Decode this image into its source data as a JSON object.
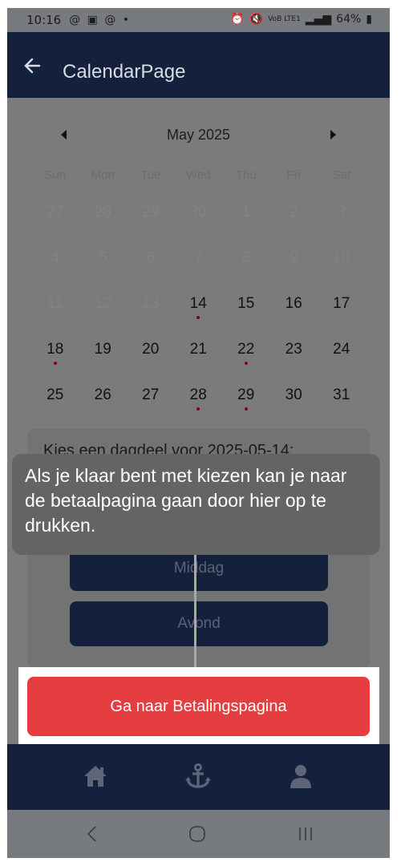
{
  "status_bar": {
    "time": "10:16",
    "left_icons": "@ ▣ @ •",
    "battery": "64%",
    "network": "VoB LTE1"
  },
  "app_bar": {
    "title": "CalendarPage"
  },
  "calendar": {
    "month": "May 2025",
    "weekdays": [
      "Sun",
      "Mon",
      "Tue",
      "Wed",
      "Thu",
      "Fri",
      "Sat"
    ],
    "days": [
      {
        "label": "27",
        "state": "faded",
        "dot": false
      },
      {
        "label": "28",
        "state": "faded",
        "dot": false
      },
      {
        "label": "29",
        "state": "faded",
        "dot": false
      },
      {
        "label": "30",
        "state": "faded",
        "dot": false
      },
      {
        "label": "1",
        "state": "faded",
        "dot": false
      },
      {
        "label": "2",
        "state": "faded",
        "dot": false
      },
      {
        "label": "3",
        "state": "faded",
        "dot": false
      },
      {
        "label": "4",
        "state": "faded",
        "dot": false
      },
      {
        "label": "5",
        "state": "faded",
        "dot": false
      },
      {
        "label": "6",
        "state": "faded",
        "dot": false
      },
      {
        "label": "7",
        "state": "faded",
        "dot": false
      },
      {
        "label": "8",
        "state": "faded",
        "dot": false
      },
      {
        "label": "9",
        "state": "faded",
        "dot": false
      },
      {
        "label": "10",
        "state": "faded",
        "dot": false
      },
      {
        "label": "11",
        "state": "faded",
        "dot": false
      },
      {
        "label": "12",
        "state": "faded",
        "dot": false
      },
      {
        "label": "13",
        "state": "faded",
        "dot": false
      },
      {
        "label": "14",
        "state": "active",
        "dot": true
      },
      {
        "label": "15",
        "state": "active",
        "dot": false
      },
      {
        "label": "16",
        "state": "active",
        "dot": false
      },
      {
        "label": "17",
        "state": "active",
        "dot": false
      },
      {
        "label": "18",
        "state": "active",
        "dot": true
      },
      {
        "label": "19",
        "state": "active",
        "dot": false
      },
      {
        "label": "20",
        "state": "active",
        "dot": false
      },
      {
        "label": "21",
        "state": "active",
        "dot": false
      },
      {
        "label": "22",
        "state": "active",
        "dot": true
      },
      {
        "label": "23",
        "state": "active",
        "dot": false
      },
      {
        "label": "24",
        "state": "active",
        "dot": false
      },
      {
        "label": "25",
        "state": "active",
        "dot": false
      },
      {
        "label": "26",
        "state": "active",
        "dot": false
      },
      {
        "label": "27",
        "state": "active",
        "dot": false
      },
      {
        "label": "28",
        "state": "active",
        "dot": true
      },
      {
        "label": "29",
        "state": "active",
        "dot": true
      },
      {
        "label": "30",
        "state": "active",
        "dot": false
      },
      {
        "label": "31",
        "state": "active",
        "dot": false
      }
    ]
  },
  "daypart_panel": {
    "title": "Kies een dagdeel voor 2025-05-14:",
    "buttons": [
      "Middag",
      "Avond"
    ]
  },
  "tooltip": {
    "text": "Als je klaar bent met kiezen kan je naar de betaalpagina gaan door hier op te drukken."
  },
  "pay_button": {
    "label": "Ga naar Betalingspagina"
  },
  "bottom_nav": {
    "items": [
      "home-icon",
      "anchor-icon",
      "user-icon"
    ]
  },
  "system_nav": {
    "items": [
      "back-icon",
      "home-circle-icon",
      "recents-icon"
    ]
  },
  "colors": {
    "navy": "#14213d",
    "accent_red": "#e63e40",
    "dot_red": "#8b0000"
  }
}
